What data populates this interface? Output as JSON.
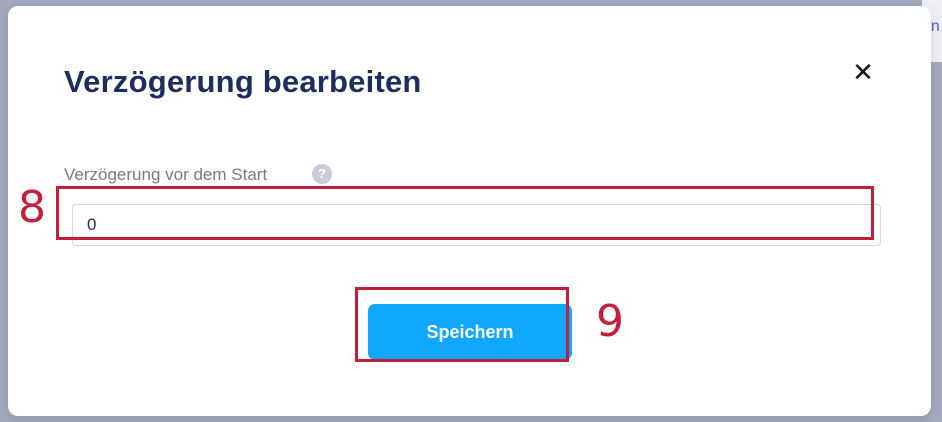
{
  "background": {
    "peek_text": "nn"
  },
  "dialog": {
    "title": "Verzögerung bearbeiten",
    "close_symbol": "✕",
    "field": {
      "label": "Verzögerung vor dem Start",
      "help_icon": "question-mark",
      "help_symbol": "?",
      "value": "0"
    },
    "save_label": "Speichern"
  },
  "annotations": [
    {
      "number": "8"
    },
    {
      "number": "9"
    }
  ],
  "colors": {
    "title": "#1d2e5e",
    "primary_button": "#10a8ff",
    "annotation": "#c41e3a",
    "overlay": "#a3a8bd"
  }
}
